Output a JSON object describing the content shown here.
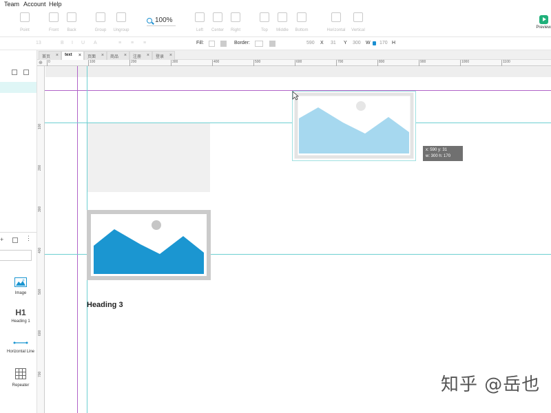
{
  "menu": [
    "Team",
    "Account",
    "Help"
  ],
  "toolbar": {
    "left_items": [
      {
        "label": "Point",
        "icon": "point-icon"
      },
      {
        "label": "Front",
        "icon": "front-icon"
      },
      {
        "label": "Back",
        "icon": "back-icon"
      },
      {
        "label": "Group",
        "icon": "group-icon"
      },
      {
        "label": "Ungroup",
        "icon": "ungroup-icon"
      }
    ],
    "zoom": "100%",
    "align_items": [
      {
        "label": "Left",
        "icon": "align-left-icon"
      },
      {
        "label": "Center",
        "icon": "align-center-icon"
      },
      {
        "label": "Right",
        "icon": "align-right-icon"
      },
      {
        "label": "Top",
        "icon": "align-top-icon"
      },
      {
        "label": "Middle",
        "icon": "align-middle-icon"
      },
      {
        "label": "Bottom",
        "icon": "align-bottom-icon"
      },
      {
        "label": "Horizontal",
        "icon": "distribute-horizontal-icon"
      },
      {
        "label": "Vertical",
        "icon": "distribute-vertical-icon"
      }
    ],
    "preview_label": "Preview"
  },
  "stylebar": {
    "font_size": "13",
    "fill_label": "Fill:",
    "border_label": "Border:",
    "x_label": "X",
    "x_value": "590",
    "y_label": "Y",
    "y_value": "31",
    "w_label": "W",
    "w_value": "300",
    "h_label": "H",
    "h_value": "170"
  },
  "tabs": [
    {
      "label": "首页",
      "active": false
    },
    {
      "label": "text",
      "active": true
    },
    {
      "label": "页面",
      "active": false
    },
    {
      "label": "商品",
      "active": false
    },
    {
      "label": "注册",
      "active": false
    },
    {
      "label": "登录",
      "active": false
    }
  ],
  "ruler_h": [
    "0",
    "100",
    "200",
    "300",
    "400",
    "500",
    "600",
    "700",
    "800",
    "900",
    "1000",
    "1100"
  ],
  "ruler_v": [
    "100",
    "200",
    "300",
    "400",
    "500",
    "600",
    "700"
  ],
  "widgets": [
    {
      "label": "Image",
      "icon": "image-icon"
    },
    {
      "label": "Heading 1",
      "icon": "heading-icon",
      "glyph": "H1"
    },
    {
      "label": "Horizontal Line",
      "icon": "horizontal-line-icon"
    },
    {
      "label": "Repeater",
      "icon": "repeater-icon"
    }
  ],
  "canvas": {
    "heading": "Heading 3",
    "coords_line1": "x: 590   y: 31",
    "coords_line2": "w: 300   h: 170",
    "colors": {
      "image_dark": "#1b96d1",
      "image_light": "#a6d8ef",
      "guide_purple": "#b063c8",
      "guide_teal": "#6ccfd1"
    }
  },
  "watermark": "知乎 @岳也"
}
